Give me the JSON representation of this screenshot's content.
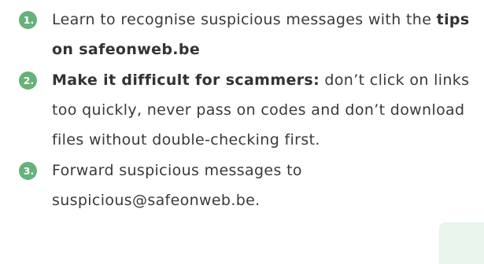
{
  "colors": {
    "text": "#3a3a3a",
    "bold_text": "#333333",
    "badge_fill": "#67b279",
    "corner_shape": "#e9f4ec"
  },
  "steps": [
    {
      "number": "1.",
      "text_before": "Learn to recognise suspicious messages with the ",
      "bold": "tips on safeonweb.be",
      "text_after": ""
    },
    {
      "number": "2.",
      "text_before": "",
      "bold": "Make it difficult for scammers:",
      "text_after": " don’t click on links too quickly, never pass on codes and don’t download files without double-checking first."
    },
    {
      "number": "3.",
      "text_before": "Forward suspicious messages to suspicious@safeonweb.be.",
      "bold": "",
      "text_after": ""
    }
  ]
}
